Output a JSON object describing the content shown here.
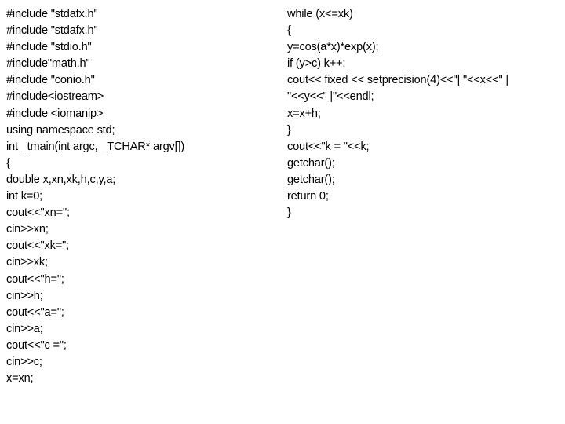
{
  "page": {
    "background_color": "#ffffff",
    "text_color": "#000000",
    "language": "C++"
  },
  "code": {
    "left_column": {
      "lines": [
        "#include \"stdafx.h\"",
        "#include \"stdafx.h\"",
        "#include \"stdio.h\"",
        "#include\"math.h\"",
        "#include \"conio.h\"",
        "#include<iostream>",
        "#include <iomanip>",
        "using namespace std;",
        "int _tmain(int argc, _TCHAR* argv[])",
        "{",
        "double x,xn,xk,h,c,y,a;",
        "int k=0;",
        "cout<<\"xn=\";",
        "cin>>xn;",
        "cout<<\"xk=\";",
        "cin>>xk;",
        "cout<<\"h=\";",
        "cin>>h;",
        "cout<<\"a=\";",
        "cin>>a;",
        "cout<<\"c =\";",
        "cin>>c;",
        "x=xn;"
      ]
    },
    "right_column": {
      "lines": [
        "while (x<=xk)",
        "{",
        "y=cos(a*x)*exp(x);",
        "if (y>c) k++;",
        "cout<< fixed << setprecision(4)<<\"| \"<<x<<\" |",
        "\"<<y<<\" |\"<<endl;",
        "x=x+h;",
        "}",
        "cout<<\"k = \"<<k;",
        "getchar();",
        "getchar();",
        "return 0;",
        "}"
      ]
    }
  }
}
